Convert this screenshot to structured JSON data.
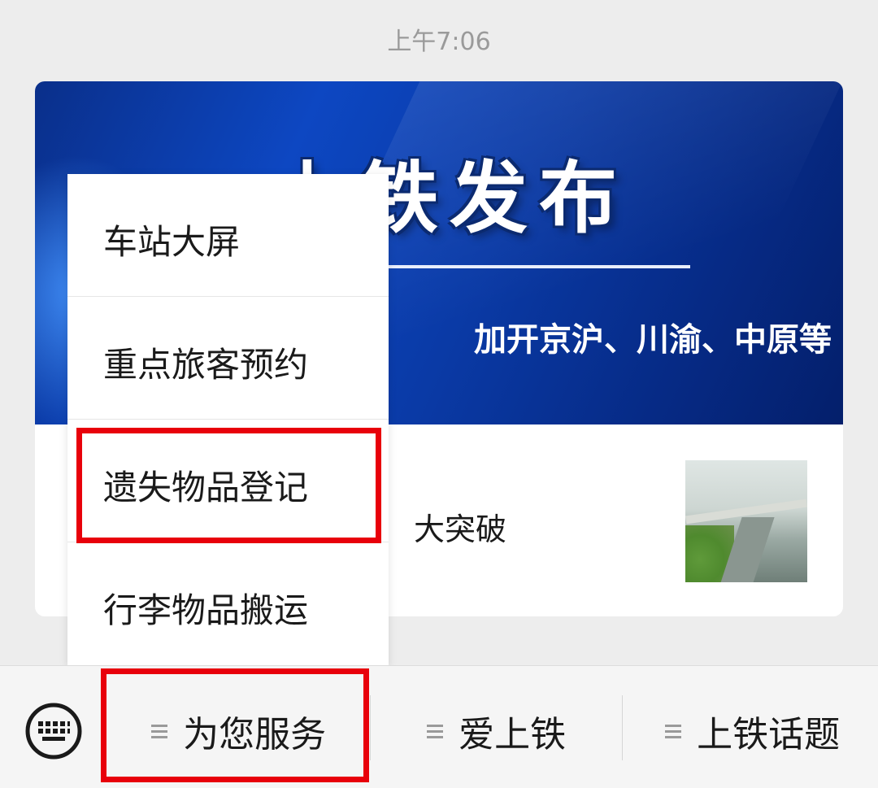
{
  "status": {
    "time": "上午7:06"
  },
  "card": {
    "banner_title": "上铁发布",
    "banner_subtitle": "加开京沪、川渝、中原等",
    "article_title": "大突破"
  },
  "menu": {
    "items": [
      {
        "label": "车站大屏"
      },
      {
        "label": "重点旅客预约"
      },
      {
        "label": "遗失物品登记"
      },
      {
        "label": "行李物品搬运"
      }
    ]
  },
  "bottom_bar": {
    "tabs": [
      {
        "label": "为您服务"
      },
      {
        "label": "爱上铁"
      },
      {
        "label": "上铁话题"
      }
    ]
  },
  "colors": {
    "highlight": "#e8000b",
    "banner": "#0a3aa6"
  }
}
